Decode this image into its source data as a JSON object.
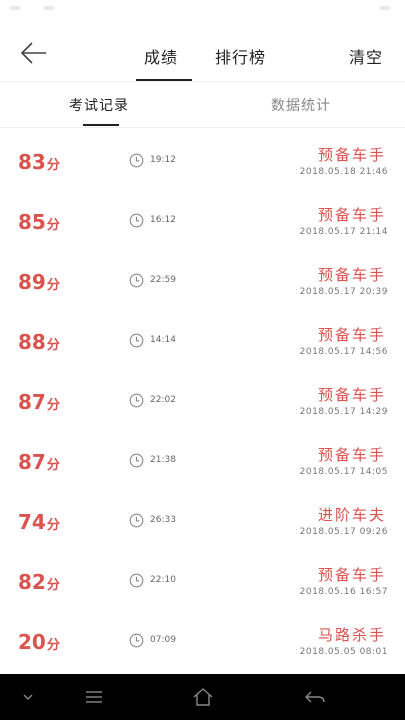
{
  "header": {
    "tabs": [
      {
        "label": "成绩"
      },
      {
        "label": "排行榜"
      }
    ],
    "clear_label": "清空"
  },
  "subtabs": [
    {
      "label": "考试记录"
    },
    {
      "label": "数据统计"
    }
  ],
  "records": [
    {
      "score": "83",
      "unit": "分",
      "duration": "19:12",
      "rank": "预备车手",
      "date": "2018.05.18  21:46"
    },
    {
      "score": "85",
      "unit": "分",
      "duration": "16:12",
      "rank": "预备车手",
      "date": "2018.05.17  21:14"
    },
    {
      "score": "89",
      "unit": "分",
      "duration": "22:59",
      "rank": "预备车手",
      "date": "2018.05.17  20:39"
    },
    {
      "score": "88",
      "unit": "分",
      "duration": "14:14",
      "rank": "预备车手",
      "date": "2018.05.17  14:56"
    },
    {
      "score": "87",
      "unit": "分",
      "duration": "22:02",
      "rank": "预备车手",
      "date": "2018.05.17  14:29"
    },
    {
      "score": "87",
      "unit": "分",
      "duration": "21:38",
      "rank": "预备车手",
      "date": "2018.05.17  14:05"
    },
    {
      "score": "74",
      "unit": "分",
      "duration": "26:33",
      "rank": "进阶车夫",
      "date": "2018.05.17  09:26"
    },
    {
      "score": "82",
      "unit": "分",
      "duration": "22:10",
      "rank": "预备车手",
      "date": "2018.05.16  16:57"
    },
    {
      "score": "20",
      "unit": "分",
      "duration": "07:09",
      "rank": "马路杀手",
      "date": "2018.05.05  08:01"
    }
  ],
  "colors": {
    "accent": "#d9534f",
    "nav_bar": "#000000"
  },
  "icons": {
    "back": "arrow-left-icon",
    "clock": "clock-icon",
    "nav": [
      "chevron-down-icon",
      "menu-icon",
      "home-icon",
      "back-icon"
    ]
  }
}
